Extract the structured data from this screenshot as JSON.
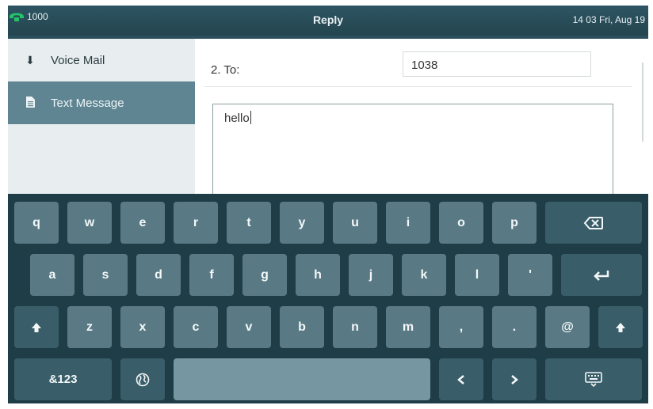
{
  "status_bar": {
    "line_label": "1000",
    "title": "Reply",
    "datetime": "14 03 Fri, Aug 19",
    "line_icon": "phone-handset-icon"
  },
  "sidebar": {
    "items": [
      {
        "label": "Voice Mail",
        "icon": "voicemail-icon",
        "selected": false
      },
      {
        "label": "Text Message",
        "icon": "document-icon",
        "selected": true
      }
    ]
  },
  "message": {
    "to_label": "2. To:",
    "to_value": "1038",
    "body": "hello"
  },
  "keyboard": {
    "row1": [
      "q",
      "w",
      "e",
      "r",
      "t",
      "y",
      "u",
      "i",
      "o",
      "p"
    ],
    "row2": [
      "a",
      "s",
      "d",
      "f",
      "g",
      "h",
      "j",
      "k",
      "l",
      "'"
    ],
    "row3": [
      "z",
      "x",
      "c",
      "v",
      "b",
      "n",
      "m",
      ",",
      ".",
      "@"
    ],
    "mode_key": "&123",
    "icons": {
      "backspace": "backspace-icon",
      "enter": "enter-icon",
      "shift": "shift-icon",
      "globe": "globe-icon",
      "left": "arrow-left-icon",
      "right": "arrow-right-icon",
      "hide": "keyboard-hide-icon"
    }
  },
  "colors": {
    "frame": "#2b4f5c",
    "keyboard_bg": "#1f3d47",
    "key": "#597a85",
    "selected_menu": "#5f8592",
    "phone_green": "#22c46a"
  }
}
